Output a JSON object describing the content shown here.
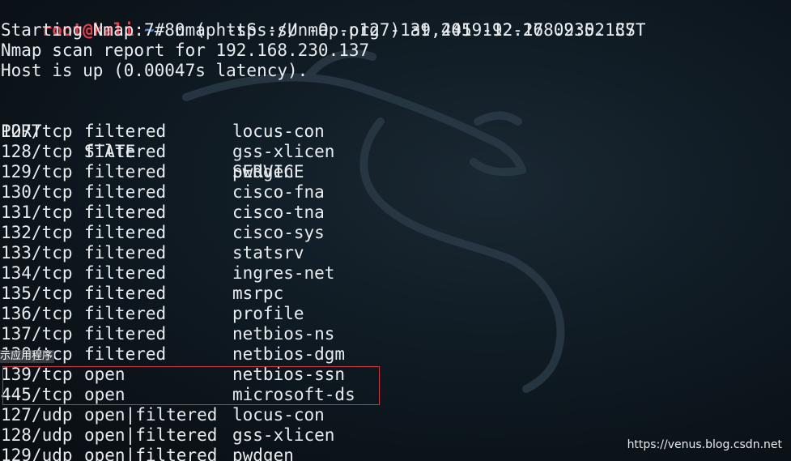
{
  "colors": {
    "prompt_user": "#e4414f",
    "prompt_path": "#4c8fe0",
    "text": "#e8ecef",
    "highlight_border": "#c9393f",
    "background": "#0b1218"
  },
  "terminal": {
    "prompt": {
      "user_host": "root@kali",
      "separator": ":",
      "path": "~",
      "symbol": "# ",
      "command": "nmap -sS -sU -O -p127-139,445 192.168.230.137"
    },
    "output_lines": [
      "Starting Nmap 7.80 ( https://nmap.org ) at 2019-12-27 09:52 CST",
      "Nmap scan report for 192.168.230.137",
      "Host is up (0.00047s latency)."
    ],
    "table": {
      "headers": [
        "PORT",
        "STATE",
        "SERVICE"
      ],
      "rows": [
        [
          "127/tcp",
          "filtered",
          "locus-con"
        ],
        [
          "128/tcp",
          "filtered",
          "gss-xlicen"
        ],
        [
          "129/tcp",
          "filtered",
          "pwdgen"
        ],
        [
          "130/tcp",
          "filtered",
          "cisco-fna"
        ],
        [
          "131/tcp",
          "filtered",
          "cisco-tna"
        ],
        [
          "132/tcp",
          "filtered",
          "cisco-sys"
        ],
        [
          "133/tcp",
          "filtered",
          "statsrv"
        ],
        [
          "134/tcp",
          "filtered",
          "ingres-net"
        ],
        [
          "135/tcp",
          "filtered",
          "msrpc"
        ],
        [
          "136/tcp",
          "filtered",
          "profile"
        ],
        [
          "137/tcp",
          "filtered",
          "netbios-ns"
        ],
        [
          "138/tcp",
          "filtered",
          "netbios-dgm"
        ],
        [
          "139/tcp",
          "open",
          "netbios-ssn"
        ],
        [
          "445/tcp",
          "open",
          "microsoft-ds"
        ],
        [
          "127/udp",
          "open|filtered",
          "locus-con"
        ],
        [
          "128/udp",
          "open|filtered",
          "gss-xlicen"
        ],
        [
          "129/udp",
          "open|filtered",
          "pwdgen"
        ]
      ]
    }
  },
  "tooltip": {
    "text": "示应用程序"
  },
  "watermark": {
    "text": "https://venus.blog.csdn.net"
  }
}
